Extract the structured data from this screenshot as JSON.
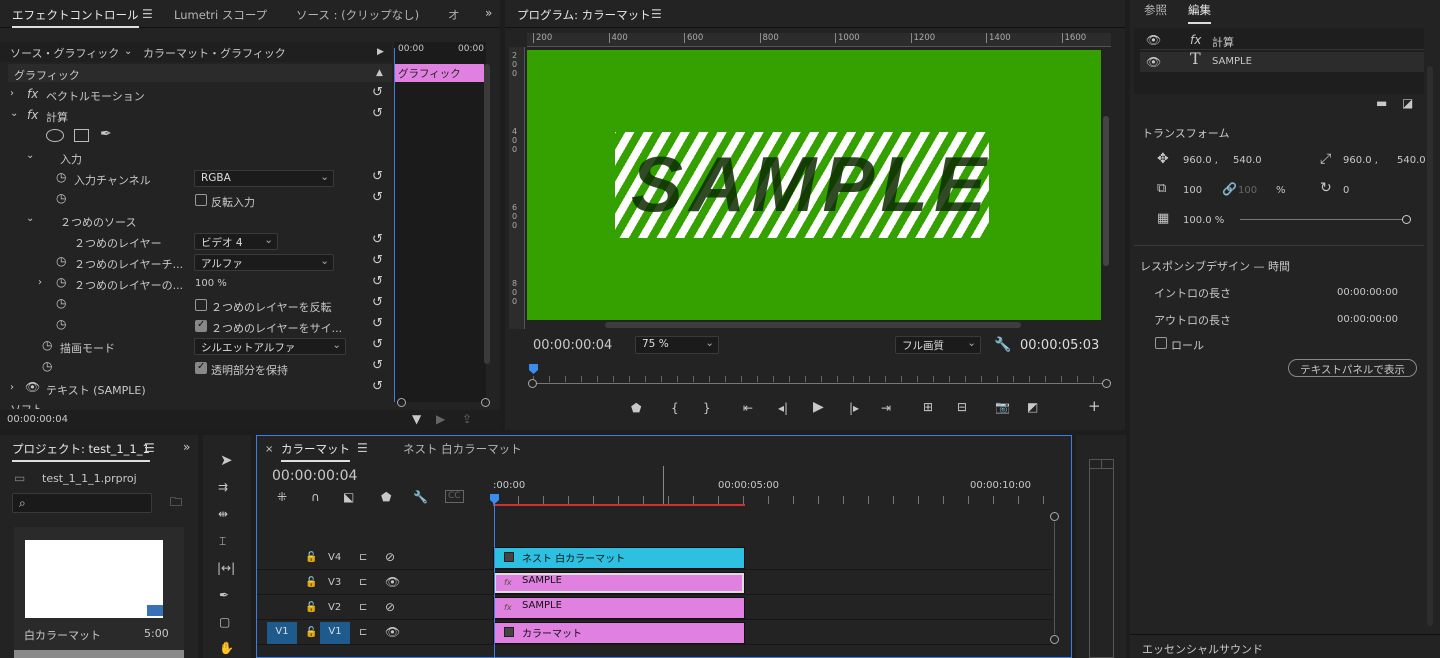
{
  "effect_controls": {
    "tabs": [
      "エフェクトコントロール",
      "Lumetri スコープ",
      "ソース : (クリップなし)",
      "オ"
    ],
    "source_label": "ソース・グラフィック",
    "clip_label": "カラーマット・グラフィック",
    "time_start": "00:00",
    "time_end": "00:00",
    "clip_bar_label": "グラフィック",
    "section": "グラフィック",
    "rows": {
      "vector_motion": "ベクトルモーション",
      "calc": "計算",
      "input": "入力",
      "input_channel": "入力チャンネル",
      "input_channel_val": "RGBA",
      "invert_input": "反転入力",
      "second_source": "２つめのソース",
      "second_layer": "２つめのレイヤー",
      "second_layer_val": "ビデオ 4",
      "second_layer_ch": "２つめのレイヤーチ...",
      "second_layer_ch_val": "アルファ",
      "second_layer_op": "２つめのレイヤーの...",
      "second_layer_op_val": "100 %",
      "invert_second": "２つめのレイヤーを反転",
      "size_second": "２つめのレイヤーをサイ...",
      "blend_mode": "描画モード",
      "blend_mode_val": "シルエットアルファ",
      "preserve_alpha": "透明部分を保持",
      "text_layer": "テキスト (SAMPLE)",
      "cut": "ソフト"
    },
    "timecode": "00:00:00:04"
  },
  "program": {
    "title": "プログラム: カラーマット",
    "ruler": [
      "200",
      "400",
      "600",
      "800",
      "1000",
      "1200",
      "1400",
      "1600"
    ],
    "vruler": [
      "2\n0\n0",
      "4\n0\n0",
      "6\n0\n0",
      "8\n0\n0"
    ],
    "sample_text": "SAMPLE",
    "timecode": "00:00:00:04",
    "zoom": "75 %",
    "quality": "フル画質",
    "duration": "00:00:05:03",
    "colors": {
      "green": "#35a100"
    }
  },
  "essential": {
    "tabs": [
      "参照",
      "編集"
    ],
    "layers": [
      {
        "name": "計算",
        "icon": "fx-icon"
      },
      {
        "name": "SAMPLE",
        "icon": "text-icon"
      }
    ],
    "transform_title": "トランスフォーム",
    "pos_x": "960.0 ,",
    "pos_y": "540.0",
    "anchor_x": "960.0 ,",
    "anchor_y": "540.0",
    "scale": "100",
    "scale2": "100",
    "pct": "%",
    "rotation": "0",
    "opacity": "100.0 %",
    "responsive_title": "レスポンシブデザイン — 時間",
    "intro_label": "イントロの長さ",
    "intro_val": "00:00:00:00",
    "outro_label": "アウトロの長さ",
    "outro_val": "00:00:00:00",
    "roll_label": "ロール",
    "text_panel_btn": "テキストパネルで表示",
    "sound_title": "エッセンシャルサウンド"
  },
  "project": {
    "tab": "プロジェクト: test_1_1_1",
    "file": "test_1_1_1.prproj",
    "item_name": "白カラーマット",
    "item_dur": "5:00"
  },
  "timeline": {
    "tabs": [
      "カラーマット",
      "ネスト 白カラーマット"
    ],
    "timecode": "00:00:00:04",
    "ruler": [
      ":00:00",
      "00:00:05:00",
      "00:00:10:00"
    ],
    "tracks": [
      "V4",
      "V3",
      "V2",
      "V1"
    ],
    "src_patch": "V1",
    "clips": [
      {
        "label": "ネスト 白カラーマット",
        "track": "V4"
      },
      {
        "label": "SAMPLE",
        "track": "V3"
      },
      {
        "label": "SAMPLE",
        "track": "V2"
      },
      {
        "label": "カラーマット",
        "track": "V1"
      }
    ],
    "colors": {
      "nest": "#2ec0e0",
      "graphic": "#e080e0",
      "work_bar": "#d03030"
    }
  }
}
